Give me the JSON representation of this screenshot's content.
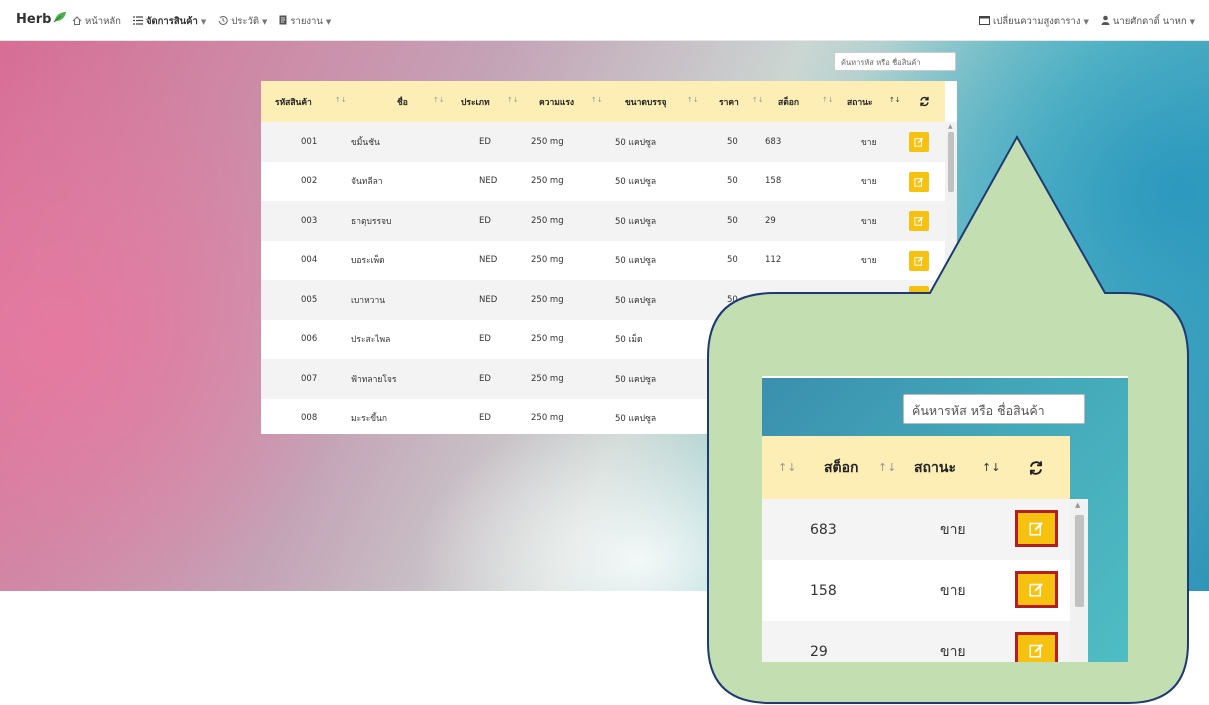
{
  "navbar": {
    "brand": "Herb",
    "home": "หน้าหลัก",
    "products": "จัดการสินค้า",
    "history": "ประวัติ",
    "reports": "รายงาน",
    "row_height": "เปลี่ยนความสูงตาราง",
    "user": "นายศักดาดิ์ นาหก"
  },
  "search": {
    "placeholder": "ค้นหารหัส หรือ ชื่อสินค้า"
  },
  "table": {
    "headers": {
      "code": "รหัสสินค้า",
      "name": "ชื่อ",
      "type": "ประเภท",
      "strength": "ความแรง",
      "package": "ขนาดบรรจุ",
      "price": "ราคา",
      "stock": "สต็อก",
      "status": "สถานะ"
    },
    "rows": [
      {
        "code": "001",
        "name": "ขมิ้นชัน",
        "type": "ED",
        "strength": "250 mg",
        "package": "50 แคปซูล",
        "price": "50",
        "stock": "683",
        "status": "ขาย"
      },
      {
        "code": "002",
        "name": "จันทลีลา",
        "type": "NED",
        "strength": "250 mg",
        "package": "50 แคปซูล",
        "price": "50",
        "stock": "158",
        "status": "ขาย"
      },
      {
        "code": "003",
        "name": "ธาตุบรรจบ",
        "type": "ED",
        "strength": "250 mg",
        "package": "50 แคปซูล",
        "price": "50",
        "stock": "29",
        "status": "ขาย"
      },
      {
        "code": "004",
        "name": "บอระเพ็ด",
        "type": "NED",
        "strength": "250 mg",
        "package": "50 แคปซูล",
        "price": "50",
        "stock": "112",
        "status": "ขาย"
      },
      {
        "code": "005",
        "name": "เบาหวาน",
        "type": "NED",
        "strength": "250 mg",
        "package": "50 แคปซูล",
        "price": "50",
        "stock": "",
        "status": ""
      },
      {
        "code": "006",
        "name": "ประสะไพล",
        "type": "ED",
        "strength": "250 mg",
        "package": "50 เม็ด",
        "price": "",
        "stock": "",
        "status": ""
      },
      {
        "code": "007",
        "name": "ฟ้าทลายโจร",
        "type": "ED",
        "strength": "250 mg",
        "package": "50 แคปซูล",
        "price": "",
        "stock": "",
        "status": ""
      },
      {
        "code": "008",
        "name": "มะระขี้นก",
        "type": "ED",
        "strength": "250 mg",
        "package": "50 แคปซูล",
        "price": "",
        "stock": "",
        "status": ""
      }
    ]
  },
  "zoom": {
    "stock_header": "สต็อก",
    "status_header": "สถานะ",
    "rows": [
      {
        "stock": "683",
        "status": "ขาย"
      },
      {
        "stock": "158",
        "status": "ขาย"
      },
      {
        "stock": "29",
        "status": "ขาย"
      }
    ]
  },
  "icons": {
    "brand": "leaf-icon",
    "home": "home-icon",
    "products": "list-icon",
    "history": "history-icon",
    "reports": "report-icon",
    "row_height": "window-icon",
    "user": "user-icon",
    "refresh": "refresh-icon",
    "edit": "edit-icon",
    "sort": "sort-icon"
  },
  "colors": {
    "header_bg": "#fdeeb6",
    "edit_button": "#f6c20f",
    "highlight_border": "#b51e1e",
    "callout_fill": "#c3dfb2",
    "callout_stroke": "#1f3a72"
  }
}
